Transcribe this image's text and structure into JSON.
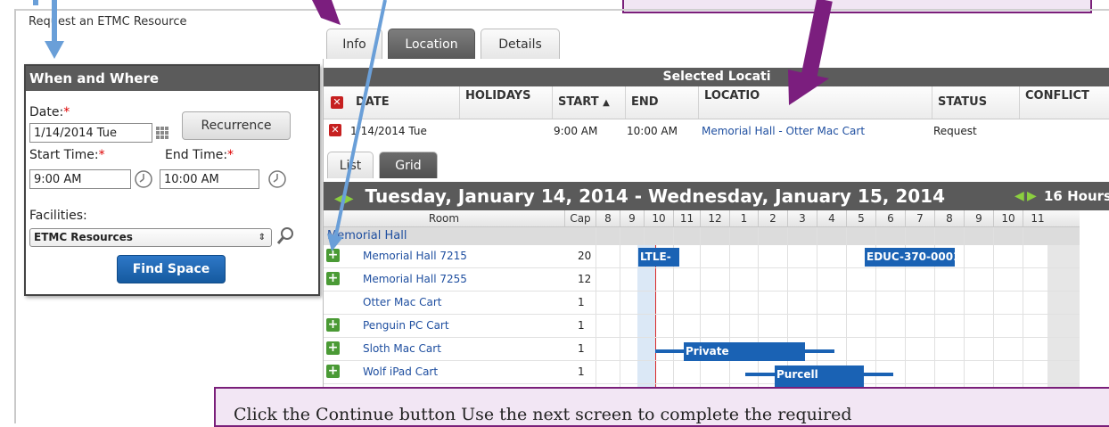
{
  "page": {
    "heading": "Request an ETMC Resource"
  },
  "when_where": {
    "title": "When and Where",
    "date_label": "Date:",
    "date_value": "1/14/2014 Tue",
    "recurrence_label": "Recurrence",
    "start_label": "Start Time:",
    "start_value": "9:00 AM",
    "end_label": "End Time:",
    "end_value": "10:00 AM",
    "required_mark": "*",
    "facilities_label": "Facilities:",
    "facilities_value": "ETMC Resources",
    "find_space_label": "Find Space"
  },
  "tabs": [
    {
      "label": "Info"
    },
    {
      "label": "Location"
    },
    {
      "label": "Details"
    }
  ],
  "selected": {
    "title": "Selected Locati",
    "headers": {
      "date": "DATE",
      "holidays": "HOLIDAYS",
      "start": "START",
      "sort_arrow": "▲",
      "end": "END",
      "location": "LOCATIO",
      "status": "STATUS",
      "conflict": "CONFLICT"
    },
    "row": {
      "date": "1/14/2014 Tue",
      "start": "9:00 AM",
      "end": "10:00 AM",
      "location": "Memorial Hall - Otter Mac Cart",
      "status": "Request"
    }
  },
  "view_tabs": [
    {
      "label": "List"
    },
    {
      "label": "Grid"
    }
  ],
  "grid": {
    "title": "Tuesday, January 14, 2014 - Wednesday, January 15, 2014",
    "hours_label": "16 Hours",
    "room_header": "Room",
    "cap_header": "Cap",
    "hours": [
      "8",
      "9",
      "10",
      "11",
      "12 PM",
      "1",
      "2",
      "3",
      "4",
      "5",
      "6",
      "7",
      "8",
      "9",
      "10",
      "11"
    ],
    "group": "Memorial Hall",
    "rooms": [
      {
        "name": "Memorial Hall 7215",
        "cap": "20"
      },
      {
        "name": "Memorial Hall 7255",
        "cap": "12"
      },
      {
        "name": "Otter Mac Cart",
        "cap": "1"
      },
      {
        "name": "Penguin PC Cart",
        "cap": "1"
      },
      {
        "name": "Sloth Mac Cart",
        "cap": "1"
      },
      {
        "name": "Wolf iPad Cart",
        "cap": "1"
      }
    ],
    "events": {
      "e1": "LTLE-",
      "e2": "EDUC-370-0001",
      "e3": "Private",
      "e4": "Purcell"
    }
  },
  "callout": {
    "text": "Click the Continue button Use the next screen to complete the required"
  },
  "colors": {
    "callout_border": "#7a1f7a",
    "arrow_blue": "#6a9fd8",
    "arrow_purple": "#7b1e7e",
    "event_blue": "#1a62b4"
  }
}
